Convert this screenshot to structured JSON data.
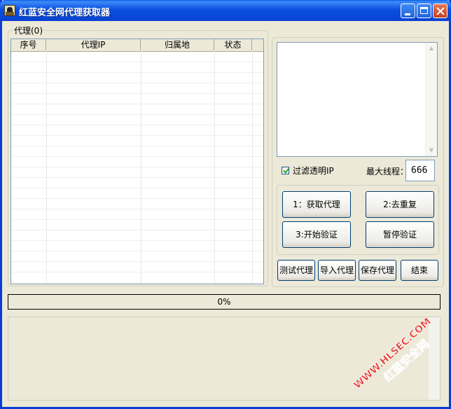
{
  "window": {
    "title": "红蓝安全网代理获取器"
  },
  "proxy_group": {
    "label": "代理(0)",
    "columns": [
      "序号",
      "代理IP",
      "归属地",
      "状态"
    ]
  },
  "options": {
    "filter_transparent_label": "过滤透明IP",
    "filter_transparent_checked": true,
    "max_threads_label": "最大线程：",
    "max_threads_value": "666"
  },
  "buttons": {
    "fetch": "1：获取代理",
    "dedupe": "2:去重复",
    "start_verify": "3:开始验证",
    "pause_verify": "暂停验证",
    "test_proxy": "测试代理",
    "import_proxy": "导入代理",
    "save_proxy": "保存代理",
    "finish": "结束"
  },
  "progress": {
    "text": "0%",
    "value": 0
  },
  "watermark": {
    "line1": "WWW.HLSEC.COM",
    "line2": "红蓝安全网"
  },
  "colors": {
    "titlebar": "#0a4fe0",
    "window_bg": "#ece9d8",
    "watermark": "#e8302a"
  }
}
